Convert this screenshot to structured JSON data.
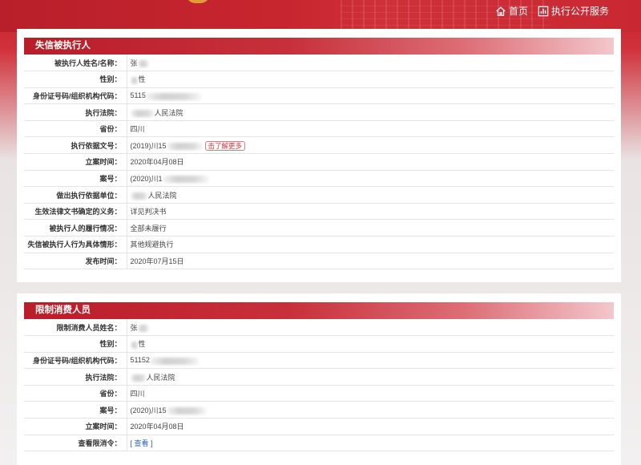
{
  "nav": {
    "home_label": "首页",
    "service_label": "执行公开服务"
  },
  "panel1": {
    "title": "失信被执行人",
    "rows": [
      {
        "label": "被执行人姓名/名称：",
        "value": "张"
      },
      {
        "label": "性别：",
        "value": "性"
      },
      {
        "label": "身份证号码/组织机构代码：",
        "value": "5115"
      },
      {
        "label": "执行法院：",
        "value": "人民法院"
      },
      {
        "label": "省份：",
        "value": "四川"
      },
      {
        "label": "执行依据文号：",
        "value": "(2019)川15"
      },
      {
        "label": "立案时间：",
        "value": "2020年04月08日"
      },
      {
        "label": "案号：",
        "value": "(2020)川1"
      },
      {
        "label": "做出执行依据单位：",
        "value": "人民法院"
      },
      {
        "label": "生效法律文书确定的义务：",
        "value": "详见判决书"
      },
      {
        "label": "被执行人的履行情况：",
        "value": "全部未履行"
      },
      {
        "label": "失信被执行人行为具体情形：",
        "value": "其他规避执行"
      },
      {
        "label": "发布时间：",
        "value": "2020年07月15日"
      }
    ],
    "more_label": "击了解更多"
  },
  "panel2": {
    "title": "限制消费人员",
    "rows": [
      {
        "label": "限制消费人员姓名：",
        "value": "张"
      },
      {
        "label": "性别：",
        "value": "性"
      },
      {
        "label": "身份证号码/组织机构代码：",
        "value": "51152"
      },
      {
        "label": "执行法院：",
        "value": "人民法院"
      },
      {
        "label": "省份：",
        "value": "四川"
      },
      {
        "label": "案号：",
        "value": "(2020)川15"
      },
      {
        "label": "立案时间：",
        "value": "2020年04月08日"
      },
      {
        "label": "查看限消令：",
        "value": ""
      }
    ],
    "view_label": "查看",
    "bracket_open": "[",
    "bracket_close": "]"
  }
}
